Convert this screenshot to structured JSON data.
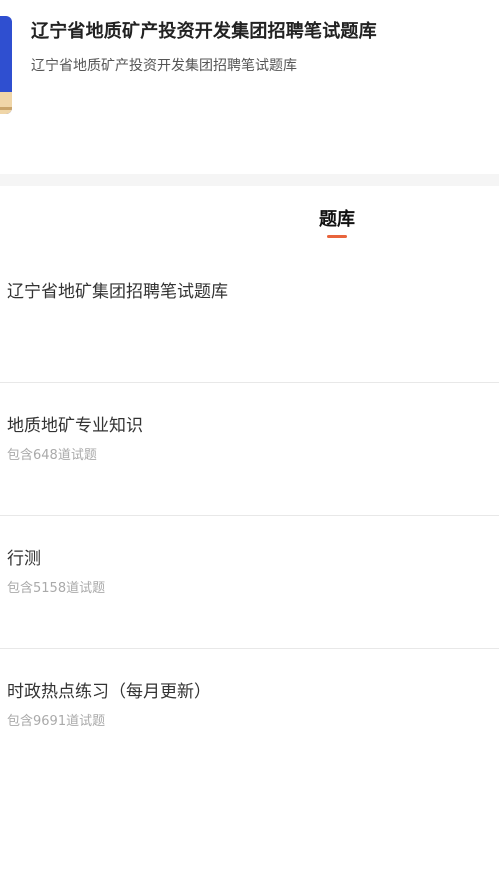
{
  "header": {
    "title": "辽宁省地质矿产投资开发集团招聘笔试题库",
    "subtitle": "辽宁省地质矿产投资开发集团招聘笔试题库"
  },
  "tabs": [
    {
      "label": "题库",
      "active": true
    }
  ],
  "colors": {
    "accent": "#e8643c",
    "cover": "#2f4fd0"
  },
  "section": {
    "title": "辽宁省地矿集团招聘笔试题库"
  },
  "items": [
    {
      "title": "地质地矿专业知识",
      "count": "包含648道试题"
    },
    {
      "title": "行测",
      "count": "包含5158道试题"
    },
    {
      "title": "时政热点练习（每月更新）",
      "count": "包含9691道试题"
    }
  ]
}
